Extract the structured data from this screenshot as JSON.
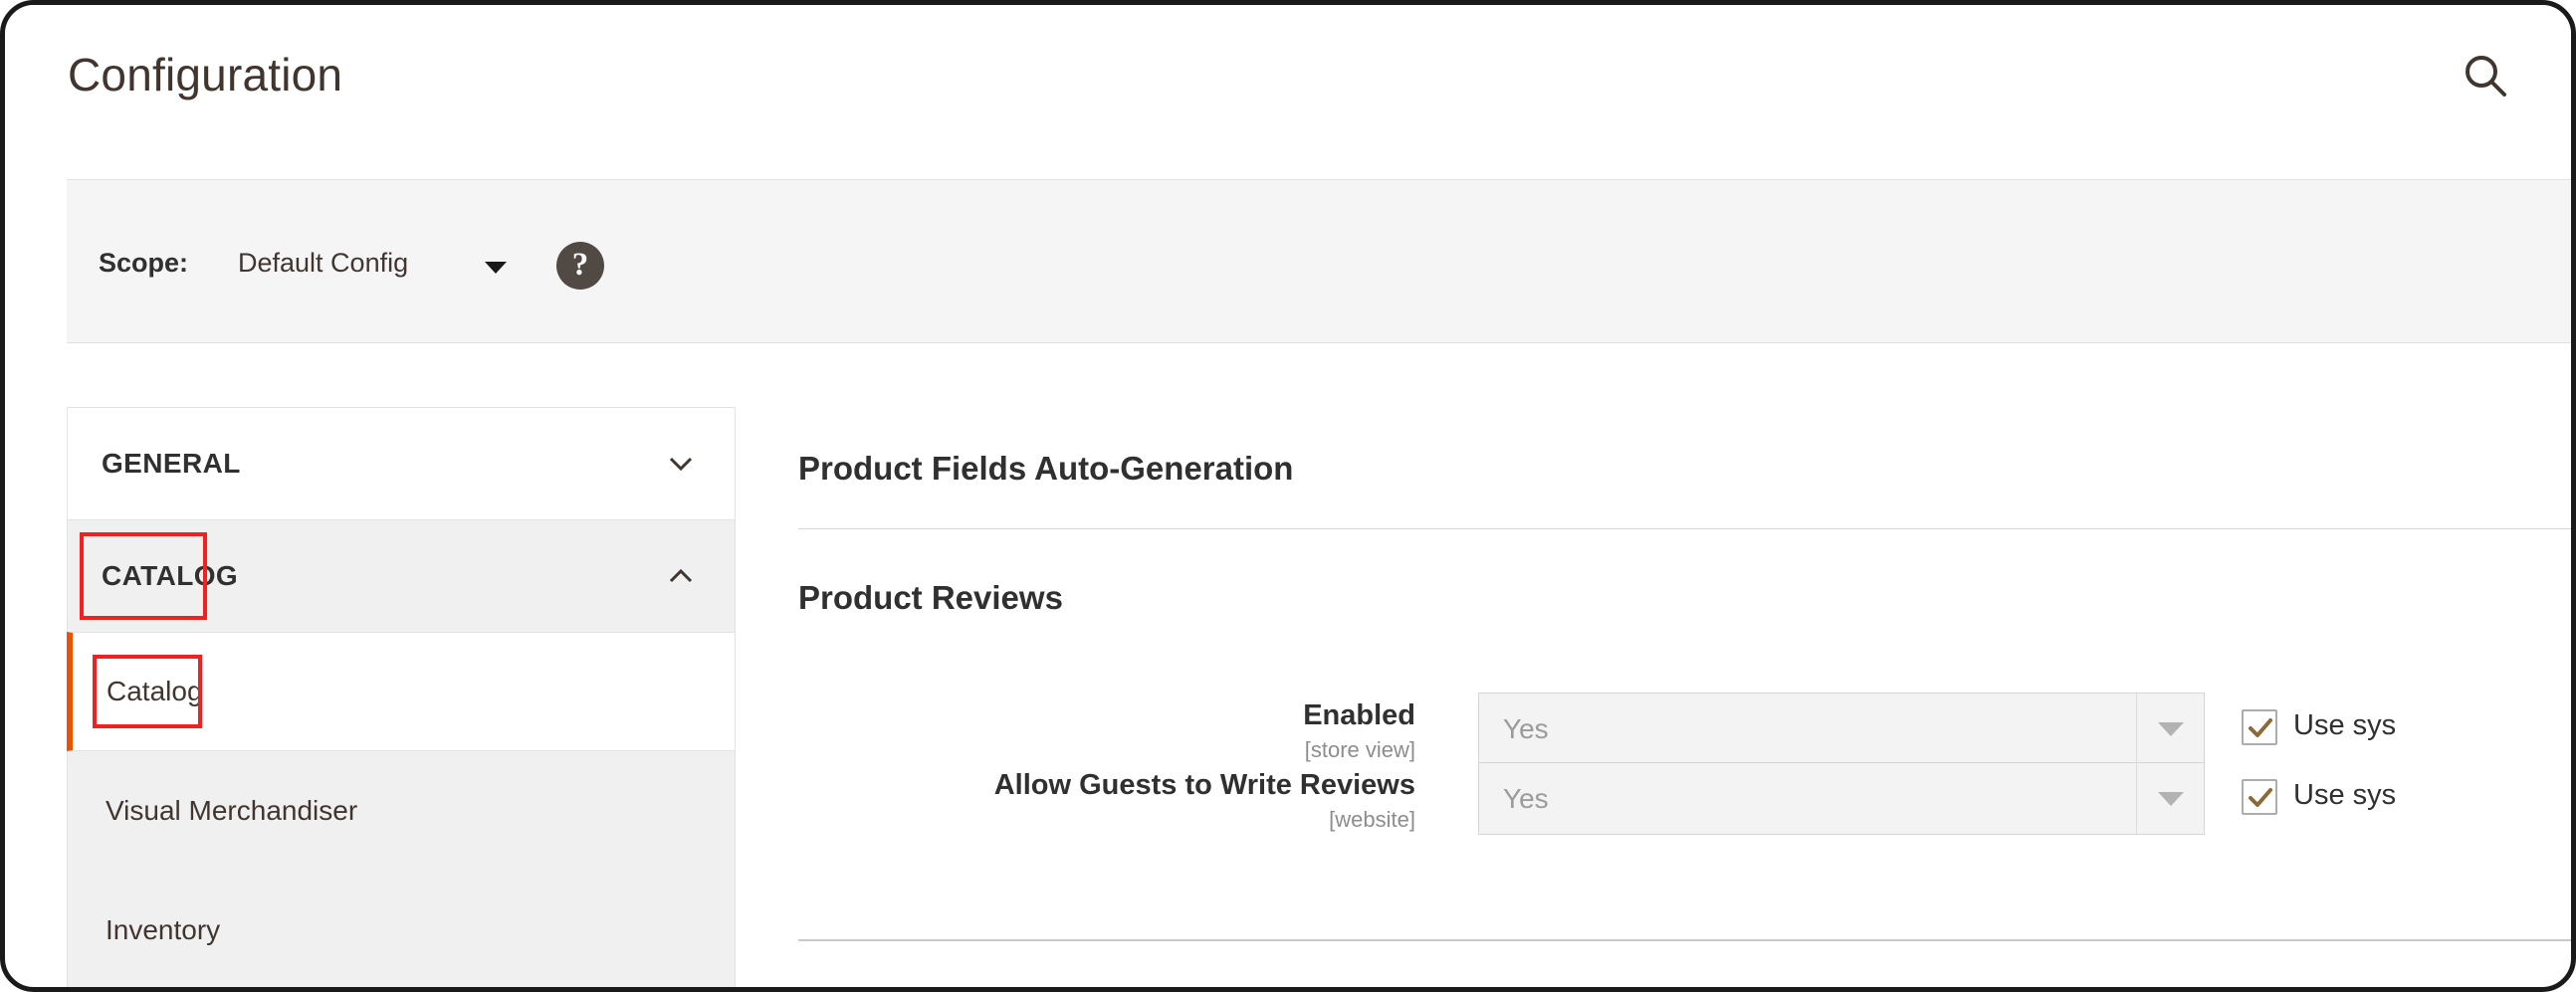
{
  "header": {
    "title": "Configuration",
    "search_icon": "search-icon"
  },
  "scope_bar": {
    "label": "Scope:",
    "selected": "Default Config",
    "caret_icon": "chevron-down-icon",
    "help_icon": "question-mark-icon",
    "help_glyph": "?"
  },
  "sidebar": {
    "sections": [
      {
        "label": "GENERAL",
        "expanded": false,
        "chevron": "chevron-down-icon"
      },
      {
        "label": "CATALOG",
        "expanded": true,
        "chevron": "chevron-up-icon"
      }
    ],
    "items": [
      {
        "label": "Catalog",
        "active": true
      },
      {
        "label": "Visual Merchandiser",
        "active": false
      },
      {
        "label": "Inventory",
        "active": false
      }
    ]
  },
  "main": {
    "sections": [
      {
        "title": "Product Fields Auto-Generation"
      },
      {
        "title": "Product Reviews"
      }
    ],
    "fields": [
      {
        "label": "Enabled",
        "scope": "[store view]",
        "value": "Yes",
        "use_system_label": "Use sys",
        "use_system_checked": true,
        "arrow_icon": "chevron-down-icon",
        "check_icon": "check-icon"
      },
      {
        "label": "Allow Guests to Write Reviews",
        "scope": "[website]",
        "value": "Yes",
        "use_system_label": "Use sys",
        "use_system_checked": true,
        "arrow_icon": "chevron-down-icon",
        "check_icon": "check-icon"
      }
    ]
  },
  "colors": {
    "accent_orange": "#eb5202",
    "annotation_red": "#f22020",
    "text_dark": "#303030",
    "scope_bar_bg": "#f5f5f5"
  }
}
